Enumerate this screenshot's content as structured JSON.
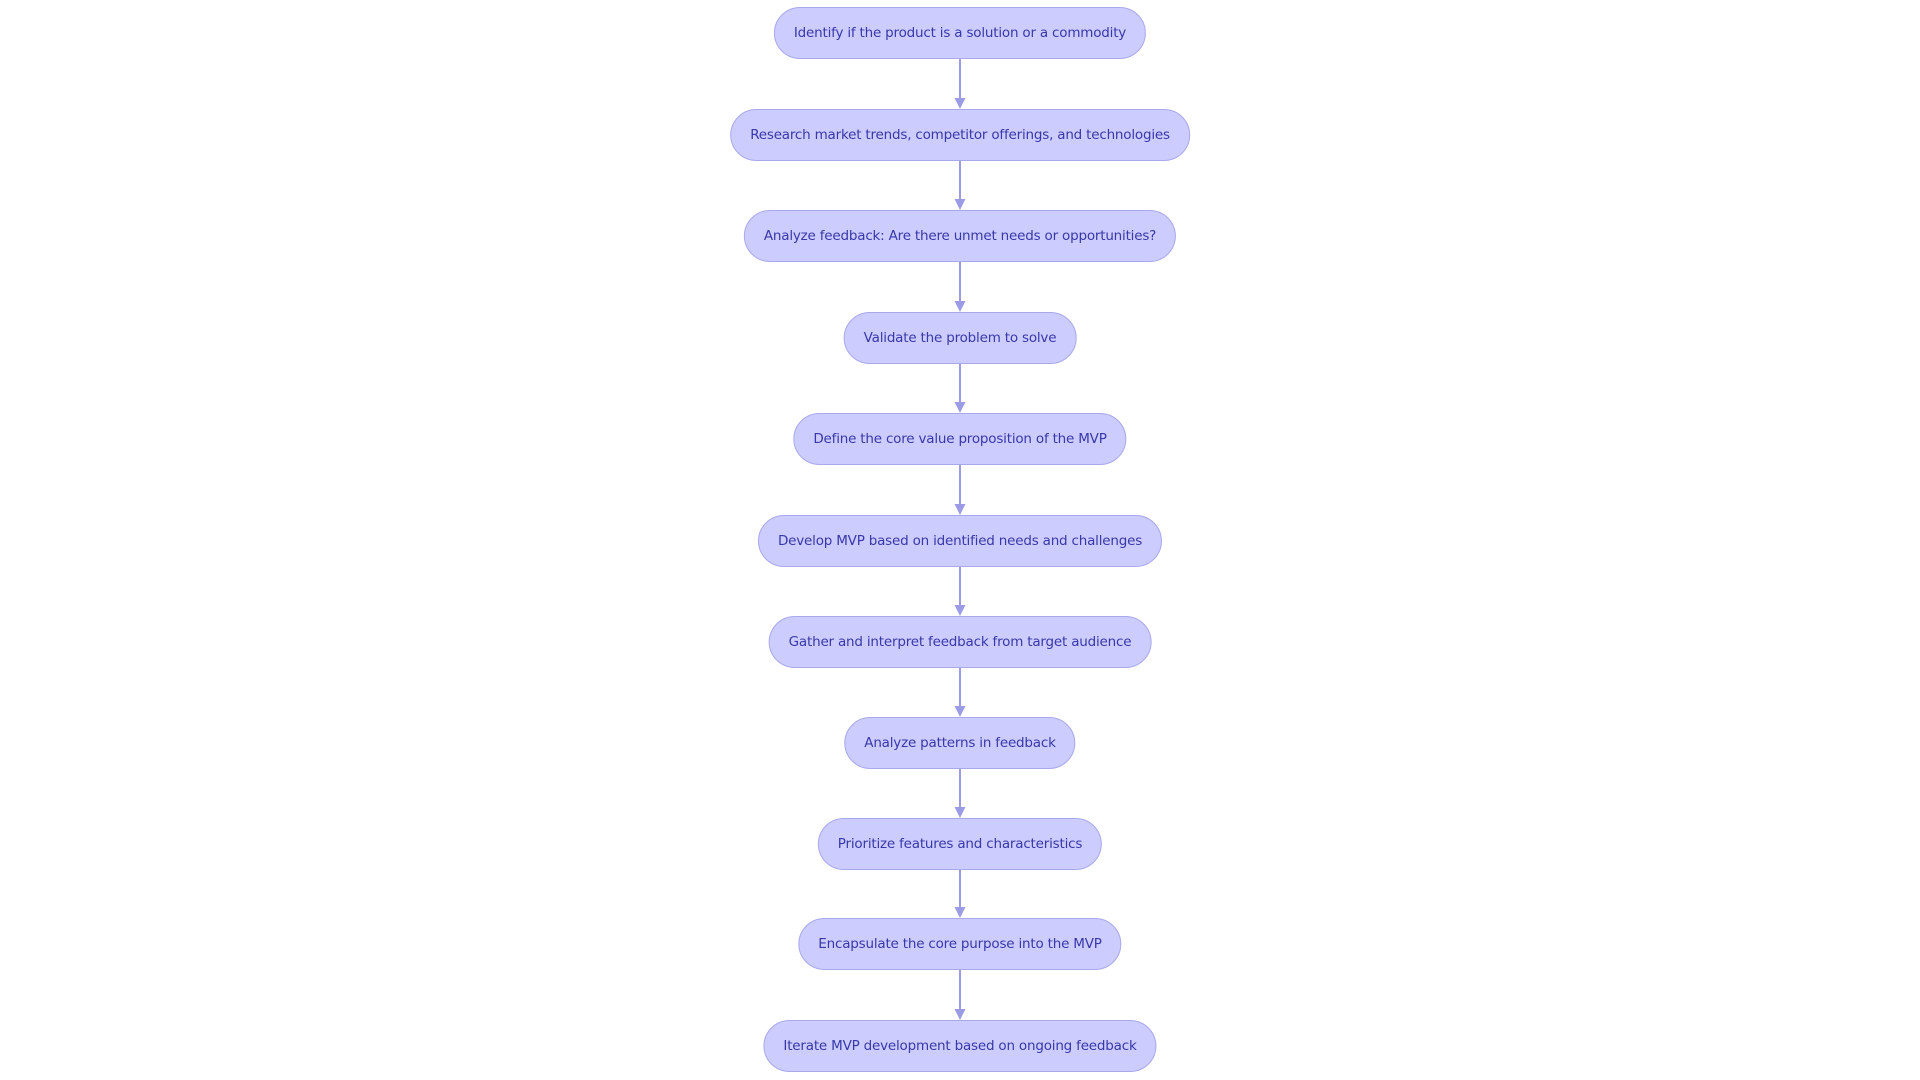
{
  "diagram": {
    "type": "flowchart",
    "direction": "top-to-bottom",
    "colors": {
      "node_fill": "#ccccff",
      "node_border": "#a8a8ec",
      "node_text": "#3838a8",
      "edge": "#9b9be6"
    },
    "nodes": [
      {
        "id": "n1",
        "label": "Identify if the product is a solution or a commodity"
      },
      {
        "id": "n2",
        "label": "Research market trends, competitor offerings, and technologies"
      },
      {
        "id": "n3",
        "label": "Analyze feedback: Are there unmet needs or opportunities?"
      },
      {
        "id": "n4",
        "label": "Validate the problem to solve"
      },
      {
        "id": "n5",
        "label": "Define the core value proposition of the MVP"
      },
      {
        "id": "n6",
        "label": "Develop MVP based on identified needs and challenges"
      },
      {
        "id": "n7",
        "label": "Gather and interpret feedback from target audience"
      },
      {
        "id": "n8",
        "label": "Analyze patterns in feedback"
      },
      {
        "id": "n9",
        "label": "Prioritize features and characteristics"
      },
      {
        "id": "n10",
        "label": "Encapsulate the core purpose into the MVP"
      },
      {
        "id": "n11",
        "label": "Iterate MVP development based on ongoing feedback"
      }
    ],
    "edges": [
      {
        "from": "n1",
        "to": "n2"
      },
      {
        "from": "n2",
        "to": "n3"
      },
      {
        "from": "n3",
        "to": "n4"
      },
      {
        "from": "n4",
        "to": "n5"
      },
      {
        "from": "n5",
        "to": "n6"
      },
      {
        "from": "n6",
        "to": "n7"
      },
      {
        "from": "n7",
        "to": "n8"
      },
      {
        "from": "n8",
        "to": "n9"
      },
      {
        "from": "n9",
        "to": "n10"
      },
      {
        "from": "n10",
        "to": "n11"
      }
    ]
  }
}
